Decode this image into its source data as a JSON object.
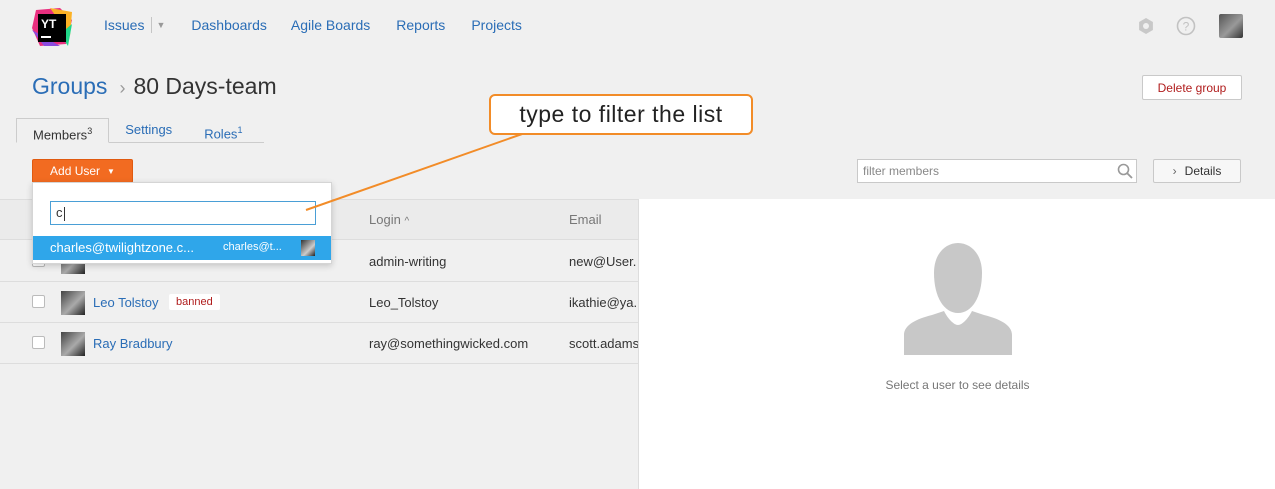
{
  "app": {
    "logo_text": "YT",
    "brand_colors": [
      "#e92f7f",
      "#fcb226",
      "#8a4bde",
      "#21d789"
    ]
  },
  "nav": {
    "items": [
      "Issues",
      "Dashboards",
      "Agile Boards",
      "Reports",
      "Projects"
    ],
    "icons": [
      "gear-icon",
      "help-icon",
      "user-avatar"
    ]
  },
  "breadcrumb": {
    "parent": "Groups",
    "separator": "›",
    "current": "80 Days-team"
  },
  "delete_button": "Delete group",
  "tabs": [
    {
      "label": "Members",
      "count": "3",
      "active": true
    },
    {
      "label": "Settings",
      "count": "",
      "active": false
    },
    {
      "label": "Roles",
      "count": "1",
      "active": false
    }
  ],
  "add_user": {
    "label": "Add User"
  },
  "filter": {
    "placeholder": "filter members"
  },
  "details_button": "Details",
  "table": {
    "columns": [
      "Login",
      "Email"
    ],
    "sort_indicator": "^",
    "rows": [
      {
        "name": "",
        "badge": "",
        "login": "admin-writing",
        "email": "new@User."
      },
      {
        "name": "Leo Tolstoy",
        "badge": "banned",
        "login": "Leo_Tolstoy",
        "email": "ikathie@ya."
      },
      {
        "name": "Ray Bradbury",
        "badge": "",
        "login": "ray@somethingwicked.com",
        "email": "scott.adams"
      }
    ]
  },
  "dropdown": {
    "query": "c",
    "option": {
      "primary": "charles@twilightzone.c...",
      "secondary": "charles@t..."
    }
  },
  "side_panel": {
    "hint": "Select a user to see details"
  },
  "callout": {
    "text": "type to filter the list",
    "color": "#f28c28"
  },
  "colors": {
    "accent": "#f26b21",
    "link": "#2a6db6",
    "selection": "#2fa6ea",
    "danger": "#b01c1c"
  }
}
